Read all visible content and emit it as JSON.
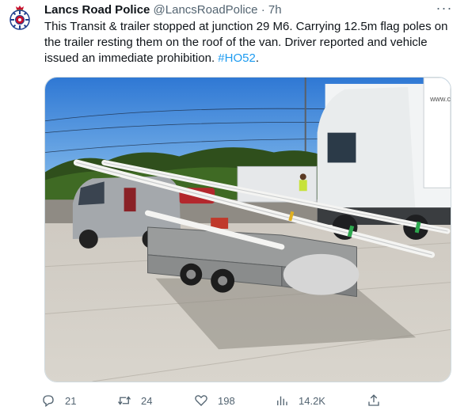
{
  "author": {
    "name": "Lancs Road Police",
    "handle": "@LancsRoadPolice",
    "separator": "·",
    "time": "7h"
  },
  "more_label": "···",
  "tweet_text": "This Transit & trailer stopped at junction 29 M6. Carrying 12.5m flag poles on the trailer resting them on the roof of the van. Driver reported and vehicle issued an immediate prohibition. ",
  "hashtag": "#HO52",
  "tweet_text_end": ".",
  "truck_text": "www.c",
  "actions": {
    "replies": "21",
    "retweets": "24",
    "likes": "198",
    "views": "14.2K"
  },
  "icons": {
    "reply": "reply-icon",
    "retweet": "retweet-icon",
    "like": "heart-icon",
    "views": "views-icon",
    "share": "share-icon"
  },
  "colors": {
    "link": "#1d9bf0",
    "muted": "#536471",
    "text": "#0f1419"
  }
}
